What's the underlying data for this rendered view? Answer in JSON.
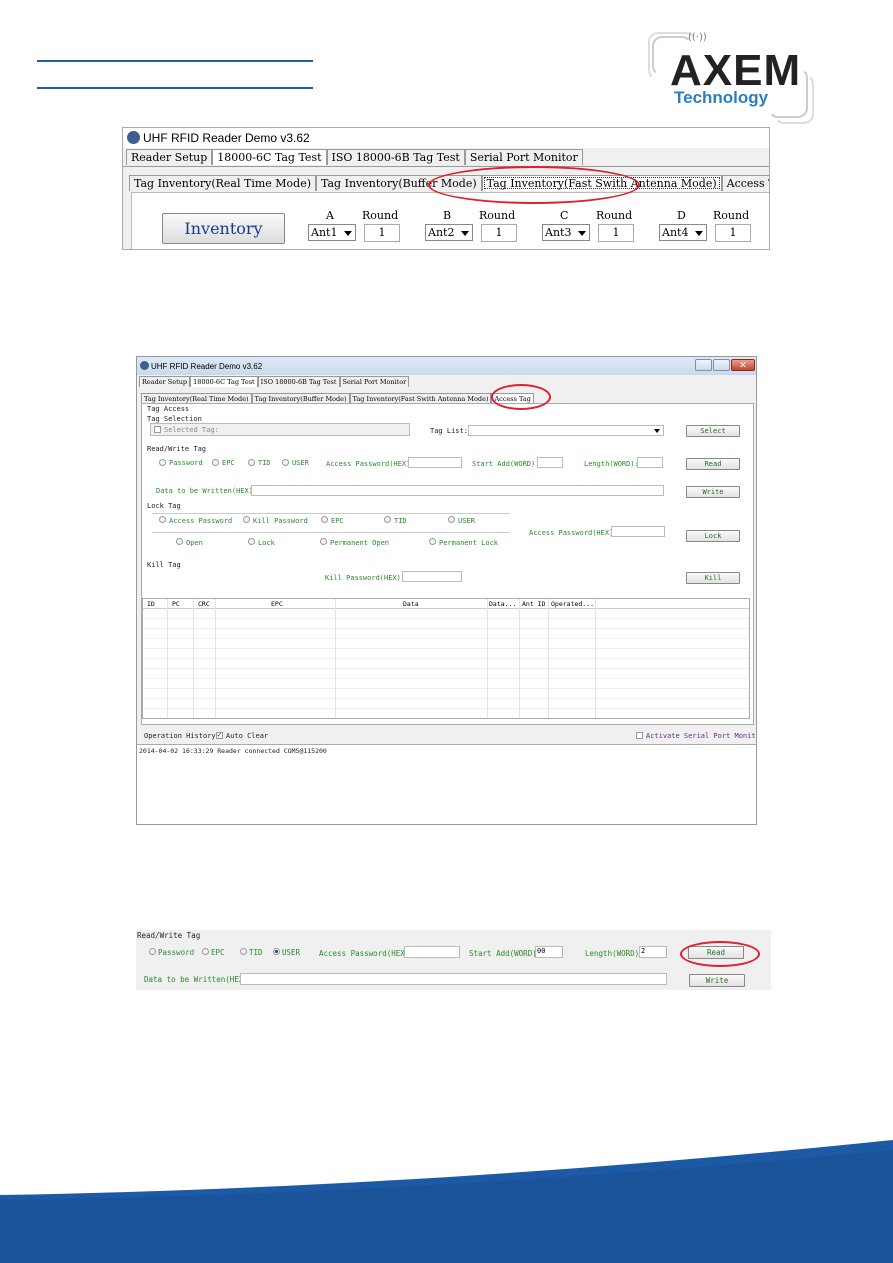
{
  "header": {
    "logo": {
      "brand": "AXEM",
      "tagline": "Technology"
    }
  },
  "screenshot1": {
    "window_title": "UHF RFID Reader Demo v3.62",
    "main_tabs": [
      "Reader Setup",
      "18000-6C Tag Test",
      "ISO 18000-6B Tag Test",
      "Serial Port Monitor"
    ],
    "active_main_tab": 1,
    "sub_tabs": [
      "Tag Inventory(Real Time Mode)",
      "Tag Inventory(Buffer Mode)",
      "Tag Inventory(Fast Swith Antenna Mode)",
      "Access Tag"
    ],
    "highlighted_sub_tab": 2,
    "inventory_button": "Inventory",
    "round_label": "Round",
    "antennas": [
      {
        "label": "A",
        "value": "Ant1",
        "round": "1"
      },
      {
        "label": "B",
        "value": "Ant2",
        "round": "1"
      },
      {
        "label": "C",
        "value": "Ant3",
        "round": "1"
      },
      {
        "label": "D",
        "value": "Ant4",
        "round": "1"
      }
    ]
  },
  "screenshot2": {
    "window_title": "UHF RFID Reader Demo v3.62",
    "main_tabs": [
      "Reader Setup",
      "18000-6C Tag Test",
      "ISO 18000-6B Tag Test",
      "Serial Port Monitor"
    ],
    "sub_tabs": [
      "Tag Inventory(Real Time Mode)",
      "Tag Inventory(Buffer Mode)",
      "Tag Inventory(Fast Swith Antenna Mode)",
      "Access Tag"
    ],
    "active_sub_tab": 3,
    "group_title": "Tag Access",
    "tag_selection": {
      "title": "Tag Selection",
      "selected_tag_label": "Selected Tag:",
      "selected_tag_checked": false,
      "tag_list_label": "Tag List:",
      "tag_list_value": "",
      "select_button": "Select"
    },
    "read_write": {
      "title": "Read/Write Tag",
      "banks": [
        "Password",
        "EPC",
        "TID",
        "USER"
      ],
      "selected_bank": null,
      "access_password_label": "Access Password(HEX)",
      "access_password_value": "",
      "start_add_label": "Start Add(WORD):",
      "start_add_value": "",
      "length_label": "Length(WORD):",
      "length_value": "",
      "read_button": "Read",
      "data_label": "Data to be Written(HEX)",
      "data_value": "",
      "write_button": "Write"
    },
    "lock_tag": {
      "title": "Lock Tag",
      "areas": [
        "Access Password",
        "Kill Password",
        "EPC",
        "TID",
        "USER"
      ],
      "types": [
        "Open",
        "Lock",
        "Permanent Open",
        "Permanent Lock"
      ],
      "access_password_label": "Access Password(HEX)",
      "access_password_value": "",
      "lock_button": "Lock"
    },
    "kill_tag": {
      "title": "Kill Tag",
      "kill_password_label": "Kill Password(HEX)",
      "kill_password_value": "",
      "kill_button": "Kill"
    },
    "table": {
      "columns": [
        "ID",
        "PC",
        "CRC",
        "EPC",
        "Data",
        "Data...",
        "Ant ID",
        "Operated..."
      ],
      "rows": []
    },
    "operation_history_label": "Operation History:",
    "auto_clear_label": "Auto Clear",
    "auto_clear_checked": true,
    "activate_monitor_label": "Activate Serial Port Monitor",
    "activate_monitor_checked": false,
    "log": [
      "2014-04-02 16:33:29 Reader connected COM5@115200"
    ]
  },
  "screenshot3": {
    "title": "Read/Write Tag",
    "banks": [
      "Password",
      "EPC",
      "TID",
      "USER"
    ],
    "selected_bank": "USER",
    "access_password_label": "Access Password(HEX)",
    "access_password_value": "",
    "start_add_label": "Start Add(WORD):",
    "start_add_value": "00",
    "length_label": "Length(WORD):",
    "length_value": "2",
    "read_button": "Read",
    "data_label": "Data to be Written(HEX)",
    "data_value": "",
    "write_button": "Write"
  },
  "colors": {
    "accent_blue": "#1f5ea8",
    "highlight_red": "#e0202a",
    "label_green": "#2a8a2a",
    "footer_blue": "#1c5aa6"
  }
}
